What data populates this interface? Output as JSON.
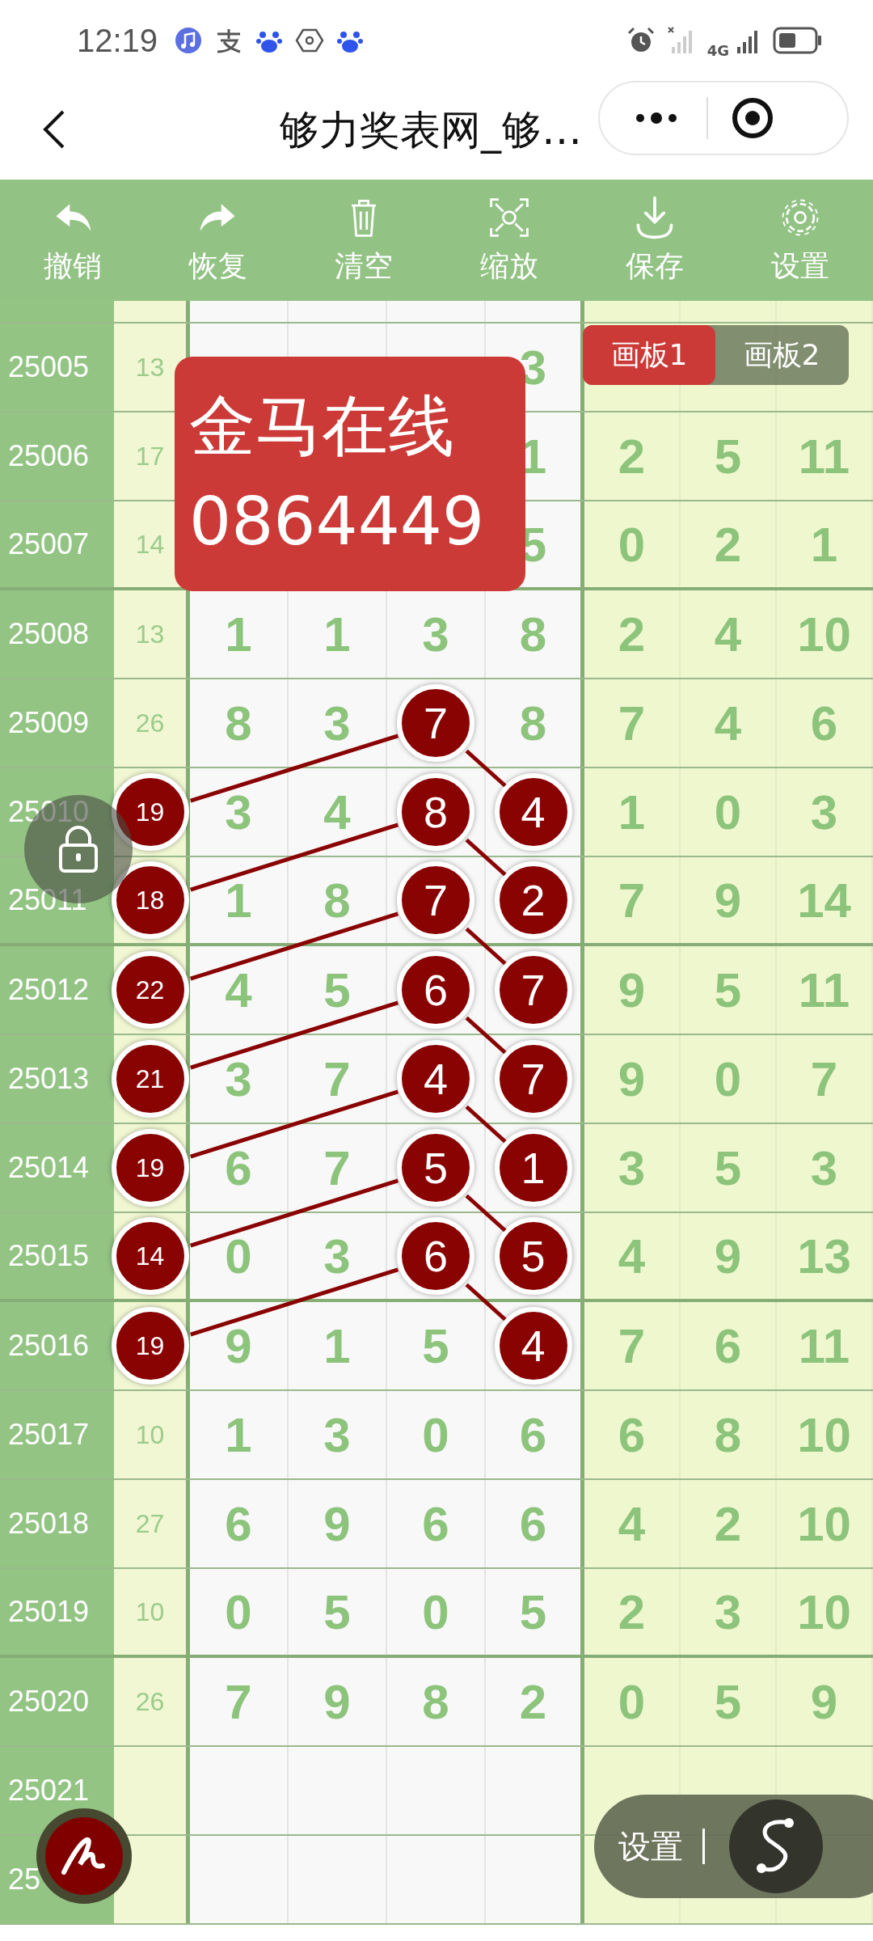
{
  "status_bar": {
    "time": "12:19",
    "network": "4G"
  },
  "header": {
    "title": "够力奖表网_够…"
  },
  "toolbar": [
    {
      "label": "撤销",
      "kind": "undo"
    },
    {
      "label": "恢复",
      "kind": "redo"
    },
    {
      "label": "清空",
      "kind": "clear"
    },
    {
      "label": "缩放",
      "kind": "zoom"
    },
    {
      "label": "保存",
      "kind": "save"
    },
    {
      "label": "设置",
      "kind": "settings"
    }
  ],
  "board_tabs": [
    {
      "label": "画板1",
      "selected": true
    },
    {
      "label": "画板2",
      "selected": false
    }
  ],
  "banner": {
    "lines": [
      "金马在线",
      "0864449"
    ]
  },
  "rows": [
    {
      "issue": "25005",
      "sum": {
        "text": "13",
        "circled": false
      },
      "digit_4": {
        "text": "3",
        "circled": false
      }
    },
    {
      "issue": "25006",
      "sum": {
        "text": "17",
        "circled": false
      },
      "digit_4": {
        "text": "1",
        "circled": false
      },
      "extra_1": "2",
      "extra_2": "5",
      "extra_3": "11"
    },
    {
      "issue": "25007",
      "sum": {
        "text": "14",
        "circled": false
      },
      "digit_4": {
        "text": "5",
        "circled": false
      },
      "extra_1": "0",
      "extra_2": "2",
      "extra_3": "1"
    },
    {
      "issue": "25008",
      "sum": {
        "text": "13",
        "circled": false
      },
      "digit_1": {
        "text": "1",
        "circled": false
      },
      "digit_2": {
        "text": "1",
        "circled": false
      },
      "digit_3": {
        "text": "3",
        "circled": false
      },
      "digit_4": {
        "text": "8",
        "circled": false
      },
      "extra_1": "2",
      "extra_2": "4",
      "extra_3": "10"
    },
    {
      "issue": "25009",
      "sum": {
        "text": "26",
        "circled": false
      },
      "digit_1": {
        "text": "8",
        "circled": false
      },
      "digit_2": {
        "text": "3",
        "circled": false
      },
      "digit_3": {
        "text": "7",
        "circled": true
      },
      "digit_4": {
        "text": "8",
        "circled": false
      },
      "extra_1": "7",
      "extra_2": "4",
      "extra_3": "6"
    },
    {
      "issue": "25010",
      "sum": {
        "text": "19",
        "circled": true
      },
      "digit_1": {
        "text": "3",
        "circled": false
      },
      "digit_2": {
        "text": "4",
        "circled": false
      },
      "digit_3": {
        "text": "8",
        "circled": true
      },
      "digit_4": {
        "text": "4",
        "circled": true
      },
      "extra_1": "1",
      "extra_2": "0",
      "extra_3": "3"
    },
    {
      "issue": "25011",
      "sum": {
        "text": "18",
        "circled": true
      },
      "digit_1": {
        "text": "1",
        "circled": false
      },
      "digit_2": {
        "text": "8",
        "circled": false
      },
      "digit_3": {
        "text": "7",
        "circled": true
      },
      "digit_4": {
        "text": "2",
        "circled": true
      },
      "extra_1": "7",
      "extra_2": "9",
      "extra_3": "14"
    },
    {
      "issue": "25012",
      "sum": {
        "text": "22",
        "circled": true
      },
      "digit_1": {
        "text": "4",
        "circled": false
      },
      "digit_2": {
        "text": "5",
        "circled": false
      },
      "digit_3": {
        "text": "6",
        "circled": true
      },
      "digit_4": {
        "text": "7",
        "circled": true
      },
      "extra_1": "9",
      "extra_2": "5",
      "extra_3": "11"
    },
    {
      "issue": "25013",
      "sum": {
        "text": "21",
        "circled": true
      },
      "digit_1": {
        "text": "3",
        "circled": false
      },
      "digit_2": {
        "text": "7",
        "circled": false
      },
      "digit_3": {
        "text": "4",
        "circled": true
      },
      "digit_4": {
        "text": "7",
        "circled": true
      },
      "extra_1": "9",
      "extra_2": "0",
      "extra_3": "7"
    },
    {
      "issue": "25014",
      "sum": {
        "text": "19",
        "circled": true
      },
      "digit_1": {
        "text": "6",
        "circled": false
      },
      "digit_2": {
        "text": "7",
        "circled": false
      },
      "digit_3": {
        "text": "5",
        "circled": true
      },
      "digit_4": {
        "text": "1",
        "circled": true
      },
      "extra_1": "3",
      "extra_2": "5",
      "extra_3": "3"
    },
    {
      "issue": "25015",
      "sum": {
        "text": "14",
        "circled": true
      },
      "digit_1": {
        "text": "0",
        "circled": false
      },
      "digit_2": {
        "text": "3",
        "circled": false
      },
      "digit_3": {
        "text": "6",
        "circled": true
      },
      "digit_4": {
        "text": "5",
        "circled": true
      },
      "extra_1": "4",
      "extra_2": "9",
      "extra_3": "13"
    },
    {
      "issue": "25016",
      "sum": {
        "text": "19",
        "circled": true
      },
      "digit_1": {
        "text": "9",
        "circled": false
      },
      "digit_2": {
        "text": "1",
        "circled": false
      },
      "digit_3": {
        "text": "5",
        "circled": false
      },
      "digit_4": {
        "text": "4",
        "circled": true
      },
      "extra_1": "7",
      "extra_2": "6",
      "extra_3": "11"
    },
    {
      "issue": "25017",
      "sum": {
        "text": "10",
        "circled": false
      },
      "digit_1": {
        "text": "1",
        "circled": false
      },
      "digit_2": {
        "text": "3",
        "circled": false
      },
      "digit_3": {
        "text": "0",
        "circled": false
      },
      "digit_4": {
        "text": "6",
        "circled": false
      },
      "extra_1": "6",
      "extra_2": "8",
      "extra_3": "10"
    },
    {
      "issue": "25018",
      "sum": {
        "text": "27",
        "circled": false
      },
      "digit_1": {
        "text": "6",
        "circled": false
      },
      "digit_2": {
        "text": "9",
        "circled": false
      },
      "digit_3": {
        "text": "6",
        "circled": false
      },
      "digit_4": {
        "text": "6",
        "circled": false
      },
      "extra_1": "4",
      "extra_2": "2",
      "extra_3": "10"
    },
    {
      "issue": "25019",
      "sum": {
        "text": "10",
        "circled": false
      },
      "digit_1": {
        "text": "0",
        "circled": false
      },
      "digit_2": {
        "text": "5",
        "circled": false
      },
      "digit_3": {
        "text": "0",
        "circled": false
      },
      "digit_4": {
        "text": "5",
        "circled": false
      },
      "extra_1": "2",
      "extra_2": "3",
      "extra_3": "10"
    },
    {
      "issue": "25020",
      "sum": {
        "text": "26",
        "circled": false
      },
      "digit_1": {
        "text": "7",
        "circled": false
      },
      "digit_2": {
        "text": "9",
        "circled": false
      },
      "digit_3": {
        "text": "8",
        "circled": false
      },
      "digit_4": {
        "text": "2",
        "circled": false
      },
      "extra_1": "0",
      "extra_2": "5",
      "extra_3": "9"
    },
    {
      "issue": "25021"
    },
    {
      "issue": "25"
    }
  ],
  "float_panel": {
    "label": "设置"
  }
}
